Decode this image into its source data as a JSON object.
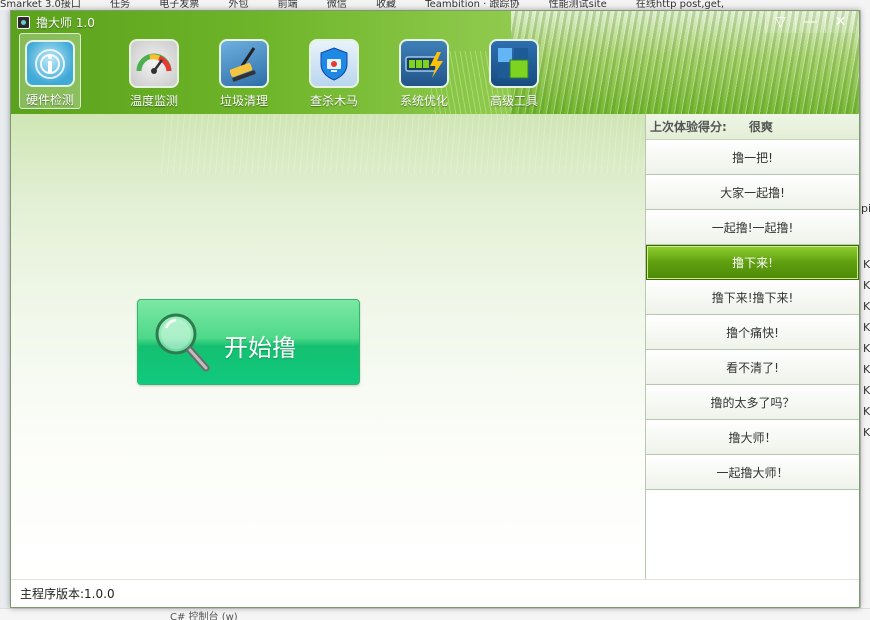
{
  "background": {
    "bookmarks": [
      "Smarket 3.0接口",
      "任务",
      "电子发票",
      "外包",
      "前端",
      "微信",
      "收藏",
      "Teambition · 跟踪协",
      "性能测试site",
      "在线http post,get,"
    ],
    "right_k_items": [
      "K",
      "K",
      "K",
      "K",
      "K",
      "K",
      "K",
      "K",
      "K"
    ],
    "right_pi": "pi",
    "bottom_ghost": "C# 控制台 (w)"
  },
  "window": {
    "title": "撸大师 1.0",
    "controls": {
      "menu": "▽",
      "minimize": "—",
      "close": "✕"
    }
  },
  "toolbar": {
    "items": [
      {
        "label": "硬件检测",
        "icon": "hardware-detect-icon"
      },
      {
        "label": "温度监测",
        "icon": "temperature-gauge-icon"
      },
      {
        "label": "垃圾清理",
        "icon": "broom-clean-icon"
      },
      {
        "label": "查杀木马",
        "icon": "shield-virus-icon"
      },
      {
        "label": "系统优化",
        "icon": "battery-lightning-icon"
      },
      {
        "label": "高级工具",
        "icon": "tools-grid-icon"
      }
    ]
  },
  "main": {
    "start_button_label": "开始撸"
  },
  "sidebar": {
    "score_label": "上次体验得分:",
    "score_value": "很爽",
    "items": [
      "撸一把!",
      "大家一起撸!",
      "一起撸!一起撸!",
      "撸下来!",
      "撸下来!撸下来!",
      "撸个痛快!",
      "看不清了!",
      "撸的太多了吗？",
      "撸大师！",
      "一起撸大师！"
    ],
    "selected_index": 3
  },
  "status": {
    "version": "主程序版本:1.0.0"
  },
  "colors": {
    "header_green": "#6fb52a",
    "selected_item": "#5f9f10",
    "start_button": "#14c070"
  }
}
